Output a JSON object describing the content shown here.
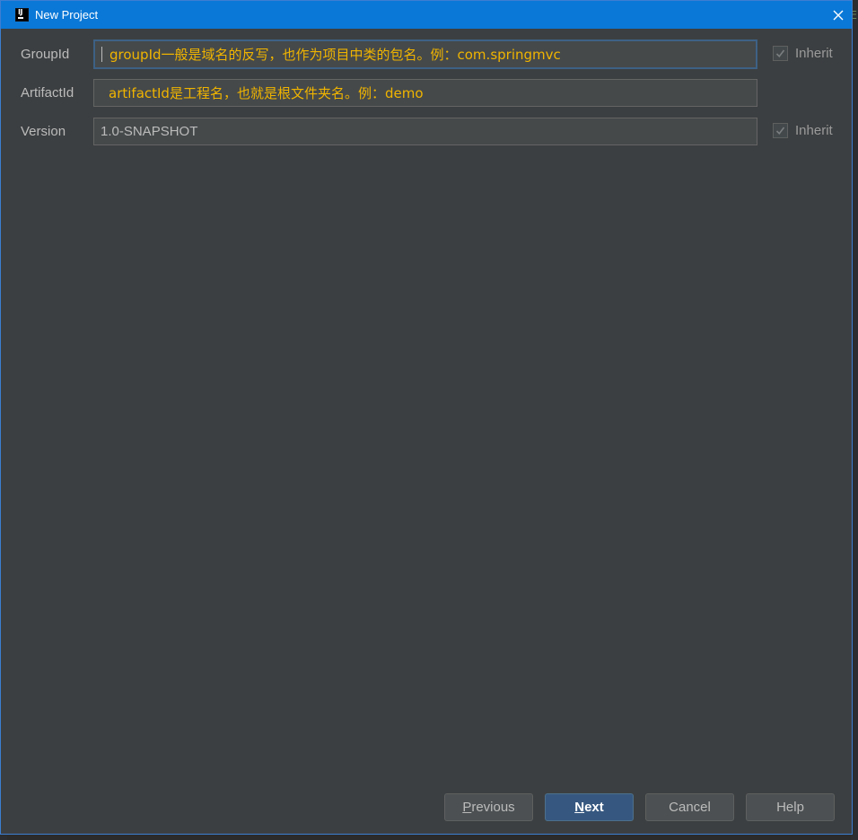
{
  "window": {
    "title": "New Project",
    "titlebar_color": "#0a78d7",
    "icon": "intellij-idea-icon"
  },
  "form": {
    "group_id": {
      "label": "GroupId",
      "value": "",
      "hint": "groupId一般是域名的反写，也作为项目中类的包名。例：com.springmvc",
      "inherit_label": "Inherit",
      "inherit_checked": true,
      "focused": true
    },
    "artifact_id": {
      "label": "ArtifactId",
      "value": "",
      "hint": "artifactId是工程名，也就是根文件夹名。例：demo"
    },
    "version": {
      "label": "Version",
      "value": "1.0-SNAPSHOT",
      "inherit_label": "Inherit",
      "inherit_checked": true
    }
  },
  "buttons": {
    "previous_first": "P",
    "previous_rest": "revious",
    "next_first": "N",
    "next_rest": "ext",
    "cancel": "Cancel",
    "help": "Help"
  },
  "colors": {
    "hint_text": "#f0b400",
    "dialog_bg": "#3c3f41",
    "primary_button": "#365880"
  }
}
